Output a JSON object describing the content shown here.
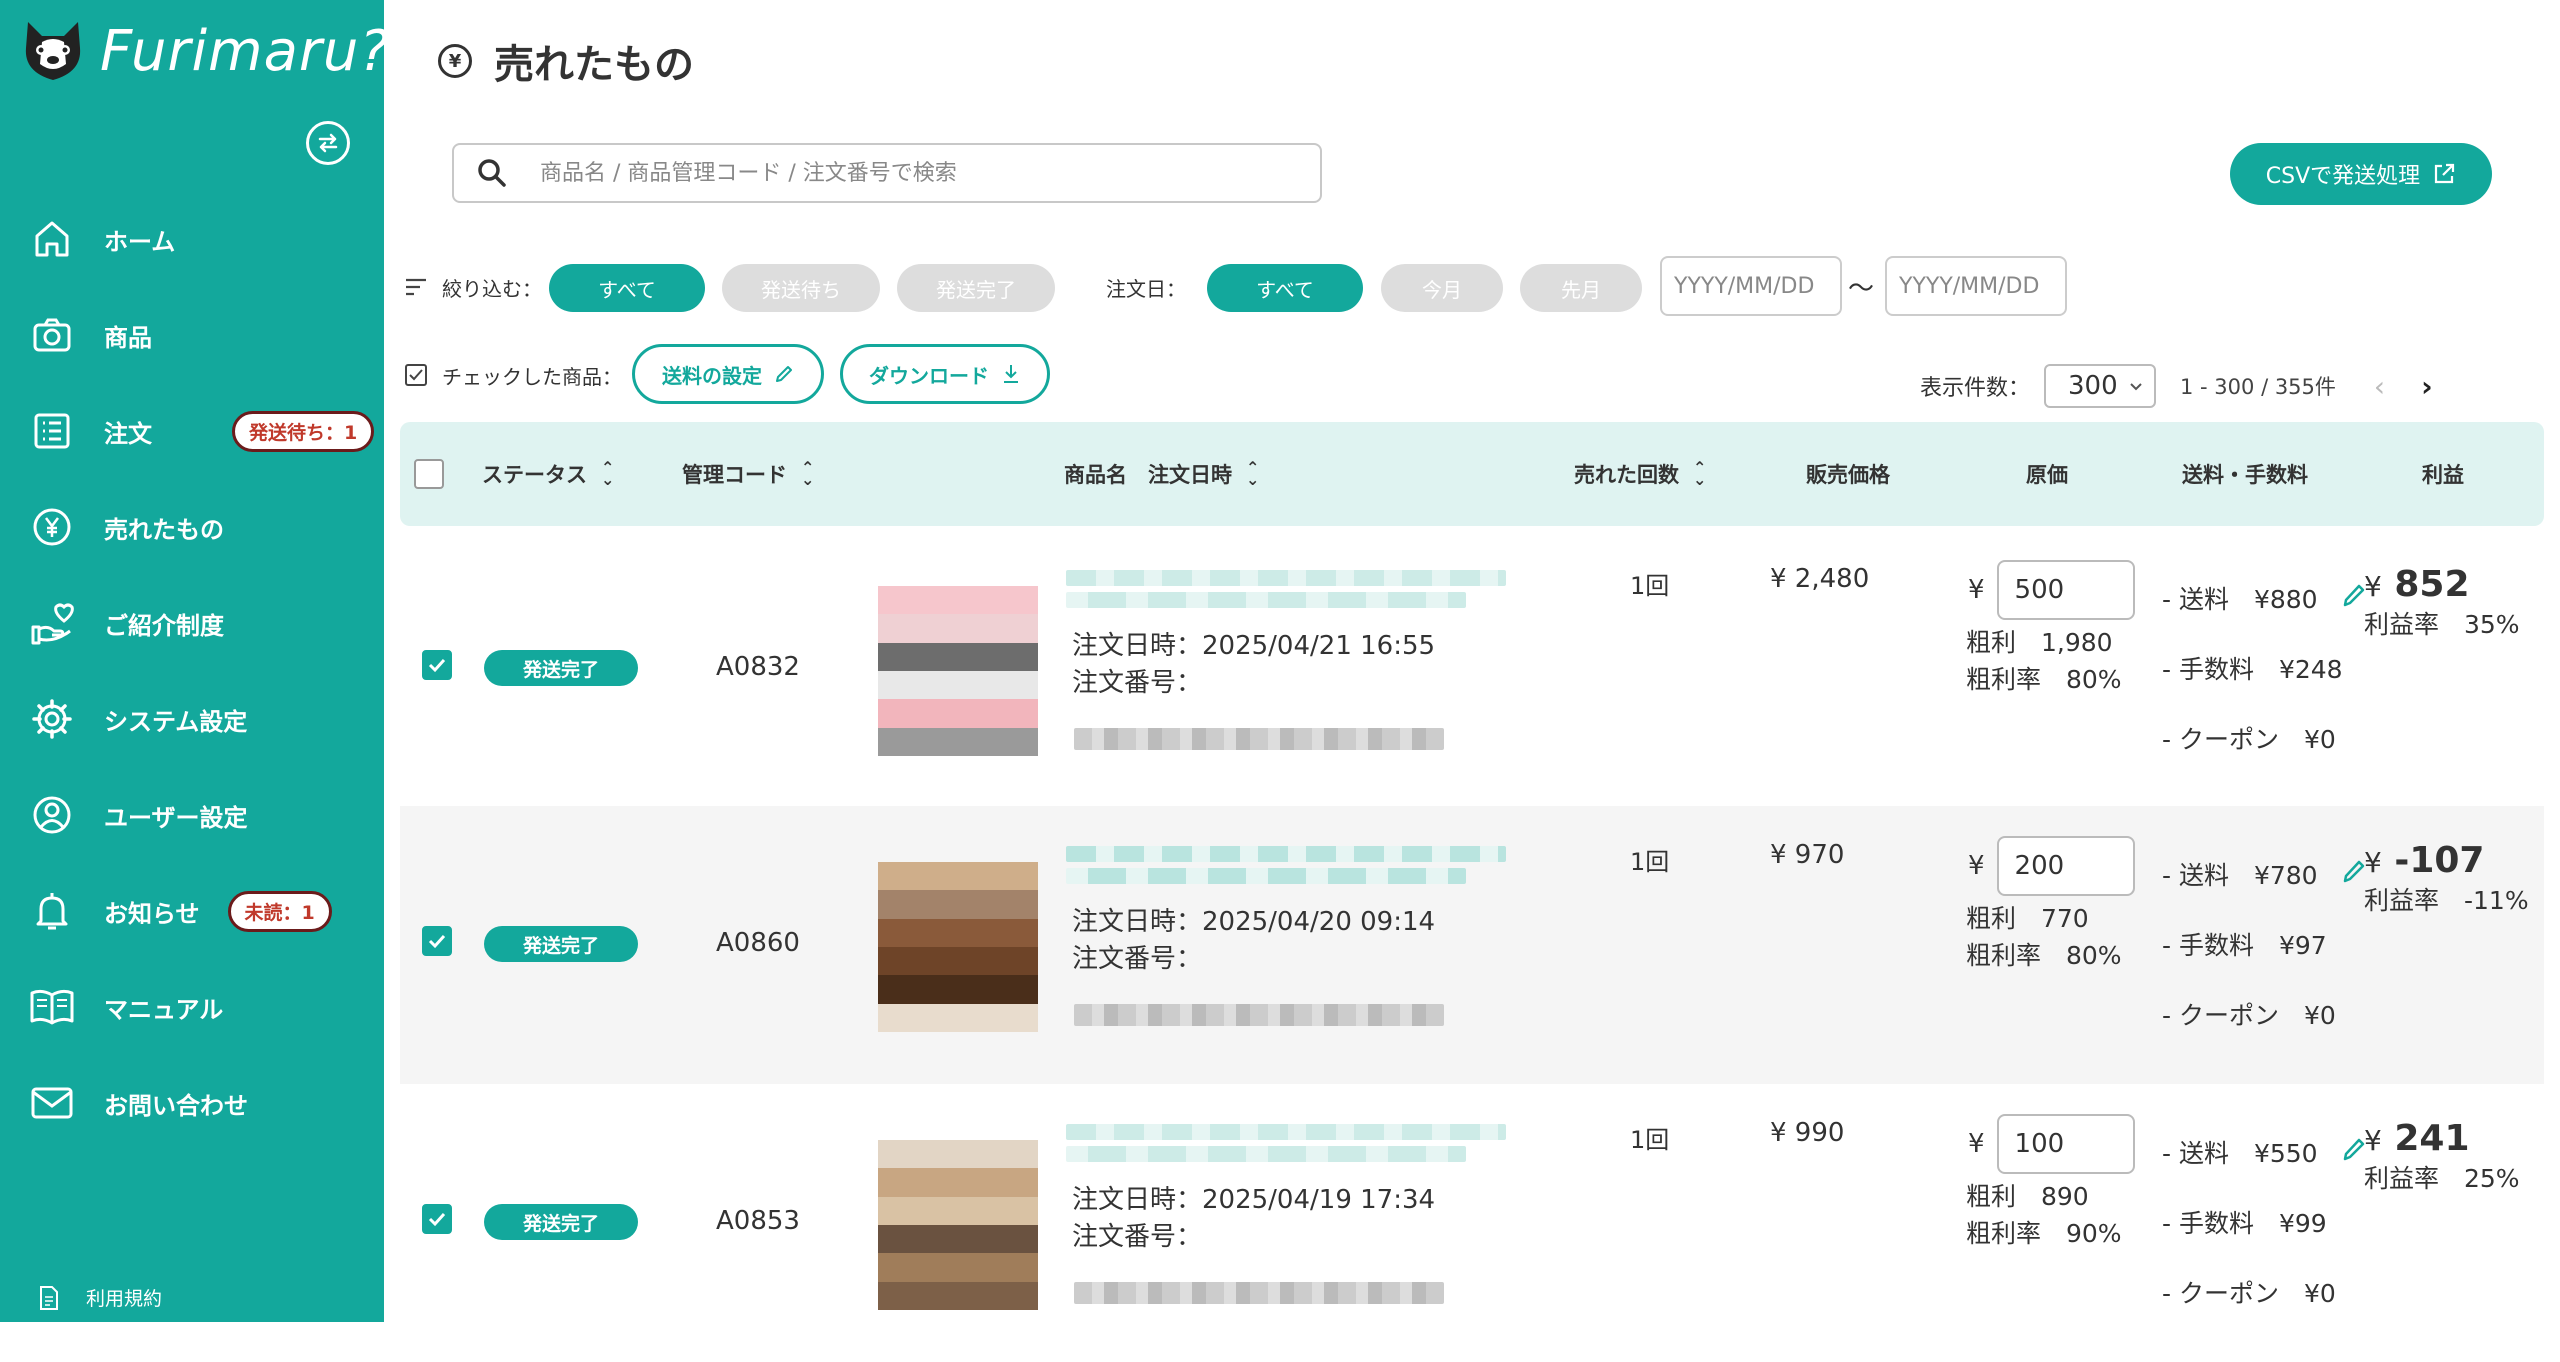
{
  "sidebar": {
    "brand": "Furimaru?",
    "items": [
      {
        "label": "ホーム",
        "icon": "home-icon"
      },
      {
        "label": "商品",
        "icon": "camera-icon"
      },
      {
        "label": "注文",
        "icon": "list-icon",
        "badge": "発送待ち：1"
      },
      {
        "label": "売れたもの",
        "icon": "yen-icon"
      },
      {
        "label": "ご紹介制度",
        "icon": "hand-heart-icon"
      },
      {
        "label": "システム設定",
        "icon": "gear-icon"
      },
      {
        "label": "ユーザー設定",
        "icon": "user-icon"
      },
      {
        "label": "お知らせ",
        "icon": "bell-icon",
        "badge": "未読：1"
      },
      {
        "label": "マニュアル",
        "icon": "book-icon"
      },
      {
        "label": "お問い合わせ",
        "icon": "mail-icon"
      }
    ],
    "terms": "利用規約"
  },
  "header": {
    "title": "売れたもの",
    "title_icon": "¥",
    "search_placeholder": "商品名 / 商品管理コード / 注文番号で検索",
    "csv_button": "CSVで発送処理"
  },
  "filters": {
    "label": "絞り込む：",
    "status_options": [
      "すべて",
      "発送待ち",
      "発送完了"
    ],
    "date_label": "注文日：",
    "date_options": [
      "すべて",
      "今月",
      "先月"
    ],
    "date_from_placeholder": "YYYY/MM/DD",
    "date_to_placeholder": "YYYY/MM/DD",
    "tilde": "〜"
  },
  "bulk": {
    "label": "チェックした商品：",
    "shipping_button": "送料の設定",
    "download_button": "ダウンロード"
  },
  "pagination": {
    "per_page_label": "表示件数：",
    "per_page_value": "300",
    "range": "1 - 300 / 355件",
    "prev": "‹",
    "next": "›"
  },
  "table": {
    "headers": {
      "status": "ステータス",
      "code": "管理コード",
      "name": "商品名",
      "order_date": "注文日時",
      "sold_count": "売れた回数",
      "price": "販売価格",
      "cost": "原価",
      "fees": "送料・手数料",
      "profit": "利益"
    },
    "rows": [
      {
        "status": "発送完了",
        "code": "A0832",
        "order_date": "注文日時：2025/04/21 16:55",
        "order_no": "注文番号：",
        "sold": "1回",
        "price": "¥ 2,480",
        "cost_symbol": "¥",
        "cost": "500",
        "gross": "粗利　1,980",
        "gross_rate": "粗利率　80%",
        "shipping": "- 送料　¥880",
        "fee": "- 手数料　¥248",
        "coupon": "- クーポン　¥0",
        "profit_symbol": "¥",
        "profit": "852",
        "profit_rate": "利益率　35%",
        "thumb_palette": [
          "#f6c6cc",
          "#f2b5bc",
          "#efd0d3",
          "#9a9a9a",
          "#6d6d6d",
          "#c6c6c6",
          "#e8e8e8"
        ]
      },
      {
        "status": "発送完了",
        "code": "A0860",
        "order_date": "注文日時：2025/04/20 09:14",
        "order_no": "注文番号：",
        "sold": "1回",
        "price": "¥ 970",
        "cost_symbol": "¥",
        "cost": "200",
        "gross": "粗利　770",
        "gross_rate": "粗利率　80%",
        "shipping": "- 送料　¥780",
        "fee": "- 手数料　¥97",
        "coupon": "- クーポン　¥0",
        "profit_symbol": "¥",
        "profit": "-107",
        "profit_rate": "利益率　-11%",
        "thumb_palette": [
          "#8a5a3a",
          "#b07a4c",
          "#6e4428",
          "#cfae8a",
          "#4a2e1a",
          "#a3836a",
          "#e8dccd"
        ]
      },
      {
        "status": "発送完了",
        "code": "A0853",
        "order_date": "注文日時：2025/04/19 17:34",
        "order_no": "注文番号：",
        "sold": "1回",
        "price": "¥ 990",
        "cost_symbol": "¥",
        "cost": "100",
        "gross": "粗利　890",
        "gross_rate": "粗利率　90%",
        "shipping": "- 送料　¥550",
        "fee": "- 手数料　¥99",
        "coupon": "- クーポン　¥0",
        "profit_symbol": "¥",
        "profit": "241",
        "profit_rate": "利益率　25%",
        "thumb_palette": [
          "#a07d5a",
          "#c8a682",
          "#7d6048",
          "#d9c2a4",
          "#8f8f8f",
          "#6a5240",
          "#e2d5c5"
        ]
      }
    ]
  },
  "colors": {
    "brand": "#13a89c",
    "header_bg": "#dff3f1",
    "badge_border": "#6b1b1b"
  }
}
